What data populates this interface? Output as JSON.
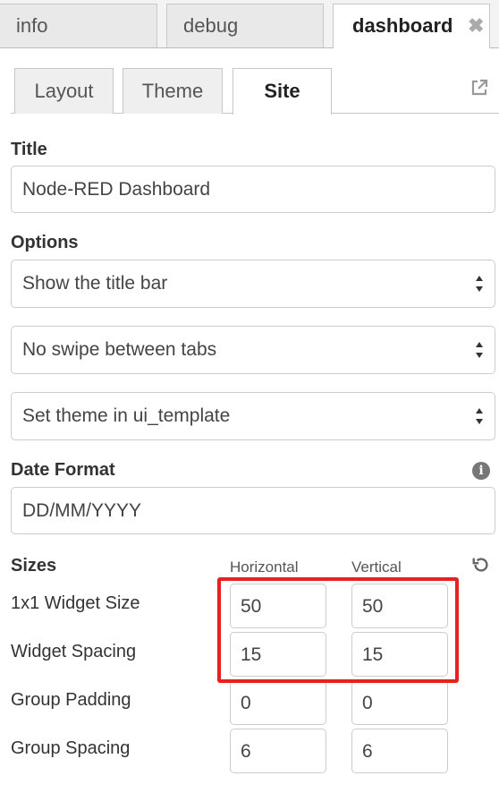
{
  "top_tabs": [
    {
      "label": "info"
    },
    {
      "label": "debug"
    },
    {
      "label": "dashboard",
      "active": true
    }
  ],
  "sub_tabs": [
    {
      "label": "Layout"
    },
    {
      "label": "Theme"
    },
    {
      "label": "Site",
      "active": true
    }
  ],
  "title_section": {
    "label": "Title",
    "value": "Node-RED Dashboard"
  },
  "options_section": {
    "label": "Options",
    "title_bar": "Show the title bar",
    "swipe": "No swipe between tabs",
    "theme": "Set theme in ui_template"
  },
  "date_section": {
    "label": "Date Format",
    "value": "DD/MM/YYYY"
  },
  "sizes_section": {
    "label": "Sizes",
    "col_horizontal": "Horizontal",
    "col_vertical": "Vertical",
    "rows": [
      {
        "label": "1x1 Widget Size",
        "horizontal": "50",
        "vertical": "50"
      },
      {
        "label": "Widget Spacing",
        "horizontal": "15",
        "vertical": "15"
      },
      {
        "label": "Group Padding",
        "horizontal": "0",
        "vertical": "0"
      },
      {
        "label": "Group Spacing",
        "horizontal": "6",
        "vertical": "6"
      }
    ]
  },
  "colors": {
    "accent_highlight": "#e8201e"
  }
}
